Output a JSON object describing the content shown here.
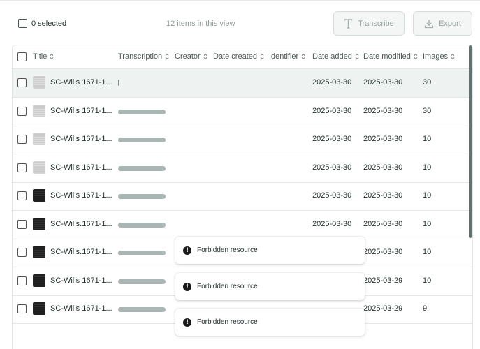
{
  "toolbar": {
    "selected_label": "0 selected",
    "items_count": "12 items in this view",
    "transcribe_label": "Transcribe",
    "export_label": "Export"
  },
  "table": {
    "columns": [
      "Title",
      "Transcription",
      "Creator",
      "Date created",
      "Identifier",
      "Date added",
      "Date modified",
      "Images"
    ],
    "rows": [
      {
        "title": "SC-Wills 1671-1...",
        "thumb": "light",
        "transcription": "tiny",
        "date_added": "2025-03-30",
        "date_modified": "2025-03-30",
        "images": "30"
      },
      {
        "title": "SC-Wills 1671-1...",
        "thumb": "light",
        "transcription": "bar",
        "date_added": "2025-03-30",
        "date_modified": "2025-03-30",
        "images": "30"
      },
      {
        "title": "SC-Wills 1671-1...",
        "thumb": "light",
        "transcription": "bar",
        "date_added": "2025-03-30",
        "date_modified": "2025-03-30",
        "images": "10"
      },
      {
        "title": "SC-Wills 1671-1...",
        "thumb": "light",
        "transcription": "bar",
        "date_added": "2025-03-30",
        "date_modified": "2025-03-30",
        "images": "10"
      },
      {
        "title": "SC-Wills 1671-1...",
        "thumb": "dark",
        "transcription": "bar",
        "date_added": "2025-03-30",
        "date_modified": "2025-03-30",
        "images": "10"
      },
      {
        "title": "SC-Wills.1671-1...",
        "thumb": "dark",
        "transcription": "bar",
        "date_added": "2025-03-30",
        "date_modified": "2025-03-30",
        "images": "10"
      },
      {
        "title": "SC-Wills.1671-1...",
        "thumb": "dark",
        "transcription": "bar",
        "date_added": "",
        "date_modified": "2025-03-30",
        "images": "10"
      },
      {
        "title": "SC-Wills 1671-1...",
        "thumb": "dark",
        "transcription": "bar",
        "date_added": "",
        "date_modified": "2025-03-29",
        "images": "10"
      },
      {
        "title": "SC-Wills 1671-1...",
        "thumb": "dark",
        "transcription": "bar",
        "date_added": "",
        "date_modified": "2025-03-29",
        "images": "9"
      }
    ]
  },
  "toasts": [
    {
      "message": "Forbidden resource"
    },
    {
      "message": "Forbidden resource"
    },
    {
      "message": "Forbidden resource"
    }
  ],
  "icons": {
    "transcribe": "text-cursor-icon",
    "export": "download-icon",
    "sort": "sort-updown-icon",
    "toast": "alert-circle-icon"
  }
}
